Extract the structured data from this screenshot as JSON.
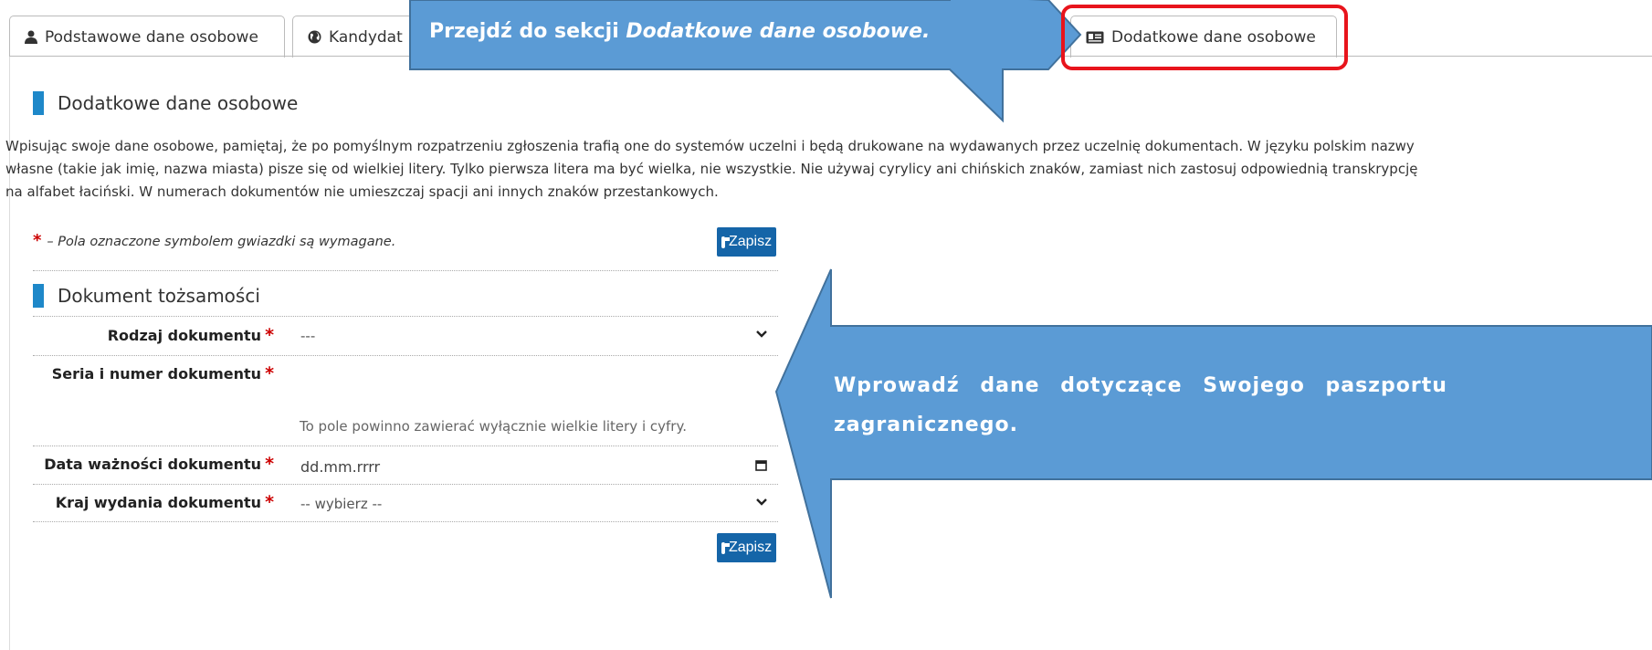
{
  "tabs": [
    {
      "label": "Podstawowe dane osobowe",
      "icon": "user-icon"
    },
    {
      "label": "Kandydat",
      "icon": "globe-icon"
    },
    {
      "label": "Dodatkowe dane osobowe",
      "icon": "id-card-icon",
      "active": true
    }
  ],
  "section": {
    "title": "Dodatkowe dane osobowe",
    "intro": "Wpisując swoje dane osobowe, pamiętaj, że po pomyślnym rozpatrzeniu zgłoszenia trafią one do systemów uczelni i będą drukowane na wydawanych przez uczelnię dokumentach. W języku polskim nazwy własne (takie jak imię, nazwa miasta) pisze się od wielkiej litery. Tylko pierwsza litera ma być wielka, nie wszystkie. Nie używaj cyrylicy ani chińskich znaków, zamiast nich zastosuj odpowiednią transkrypcję na alfabet łaciński. W numerach dokumentów nie umieszczaj spacji ani innych znaków przestankowych.",
    "required_star": "*",
    "required_note": "– Pola oznaczone symbolem gwiazdki są wymagane.",
    "save_label": "Zapisz"
  },
  "document": {
    "title": "Dokument tożsamości",
    "fields": [
      {
        "label": "Rodzaj dokumentu",
        "value": "---"
      },
      {
        "label": "Seria i numer dokumentu",
        "value": "",
        "hint": "To pole powinno zawierać wyłącznie wielkie litery i cyfry."
      },
      {
        "label": "Data ważności dokumentu",
        "placeholder": "dd.mm.rrrr"
      },
      {
        "label": "Kraj wydania dokumentu",
        "value": "-- wybierz --"
      }
    ],
    "save_label": "Zapisz"
  },
  "callouts": {
    "top": {
      "prefix": "Przejdź do sekcji ",
      "emphasis": "Dodatkowe dane osobowe."
    },
    "middle": {
      "line1": "Wprowadź dane dotyczące Swojego paszportu",
      "line2": "zagranicznego."
    }
  },
  "colors": {
    "callout_fill": "#5b9bd5",
    "callout_stroke": "#41719c",
    "highlight": "#e8141c",
    "section_bar": "#1e88c9",
    "save_button": "#1565a8"
  }
}
